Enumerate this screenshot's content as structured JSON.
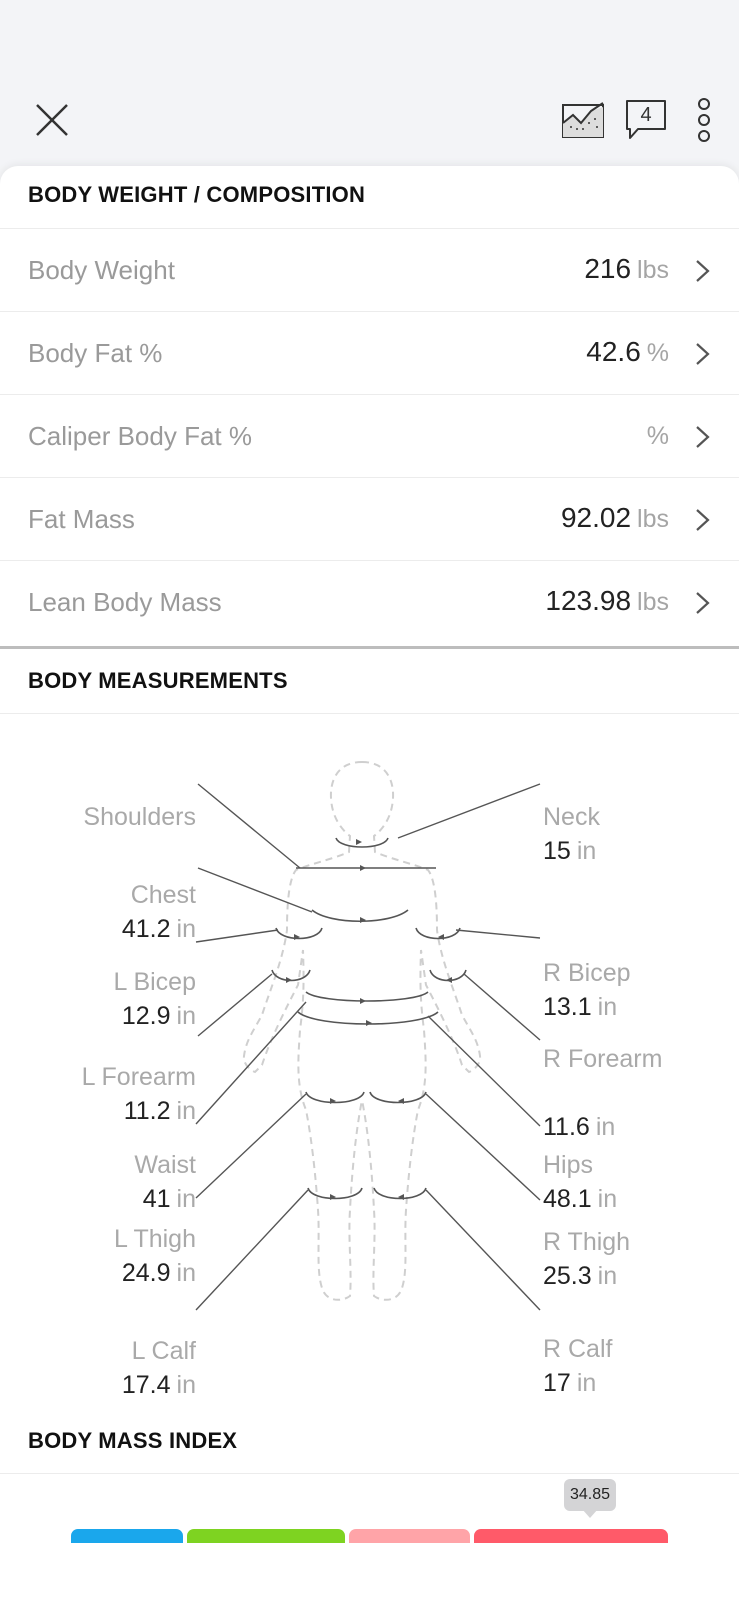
{
  "header": {
    "comment_count": "4",
    "icons": [
      "close-icon",
      "trend-chart-icon",
      "comment-icon",
      "more-vertical-icon"
    ]
  },
  "composition": {
    "title": "BODY WEIGHT / COMPOSITION",
    "rows": [
      {
        "label": "Body Weight",
        "value": "216",
        "unit": "lbs"
      },
      {
        "label": "Body Fat %",
        "value": "42.6",
        "unit": "%"
      },
      {
        "label": "Caliper Body Fat %",
        "value": "",
        "unit": "%"
      },
      {
        "label": "Fat Mass",
        "value": "92.02",
        "unit": "lbs"
      },
      {
        "label": "Lean Body Mass",
        "value": "123.98",
        "unit": "lbs"
      }
    ]
  },
  "measurements": {
    "title": "BODY MEASUREMENTS",
    "unit": "in",
    "shoulders": {
      "label": "Shoulders",
      "value": ""
    },
    "chest": {
      "label": "Chest",
      "value": "41.2"
    },
    "l_bicep": {
      "label": "L Bicep",
      "value": "12.9"
    },
    "l_forearm": {
      "label": "L Forearm",
      "value": "11.2"
    },
    "waist": {
      "label": "Waist",
      "value": "41"
    },
    "l_thigh": {
      "label": "L Thigh",
      "value": "24.9"
    },
    "l_calf": {
      "label": "L Calf",
      "value": "17.4"
    },
    "neck": {
      "label": "Neck",
      "value": "15"
    },
    "r_bicep": {
      "label": "R Bicep",
      "value": "13.1"
    },
    "r_forearm": {
      "label": "R Forearm",
      "value": "11.6"
    },
    "hips": {
      "label": "Hips",
      "value": "48.1"
    },
    "r_thigh": {
      "label": "R Thigh",
      "value": "25.3"
    },
    "r_calf": {
      "label": "R Calf",
      "value": "17"
    }
  },
  "bmi": {
    "title": "BODY MASS INDEX",
    "value": "34.85",
    "colors": [
      "#1aa7ec",
      "#7ed321",
      "#ffa4a8",
      "#ff5a69"
    ]
  }
}
